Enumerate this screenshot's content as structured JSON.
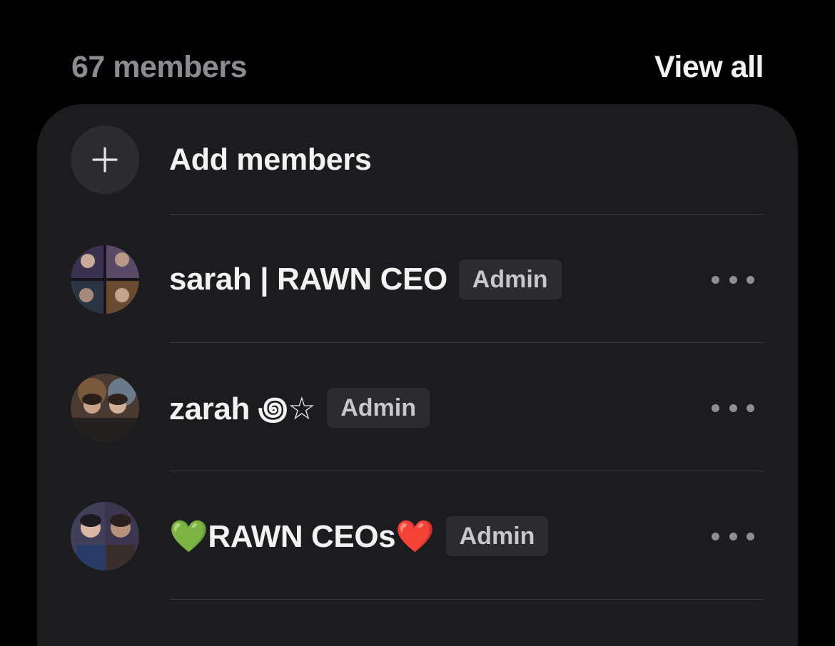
{
  "header": {
    "member_count": "67 members",
    "view_all": "View all"
  },
  "add_members": {
    "label": "Add members",
    "icon": "plus-icon"
  },
  "members": [
    {
      "name": "sarah | RAWN CEO",
      "role": "Admin",
      "menu_icon": "more-horizontal-icon"
    },
    {
      "name": "zarah ꩜☆",
      "role": "Admin",
      "menu_icon": "more-horizontal-icon"
    },
    {
      "name": "💚RAWN CEOs❤️",
      "role": "Admin",
      "menu_icon": "more-horizontal-icon"
    }
  ],
  "colors": {
    "background": "#000000",
    "card": "#1c1c1e",
    "badge": "#2c2c2e",
    "muted_text": "#8b8b92",
    "primary_text": "#f2f2f2"
  }
}
